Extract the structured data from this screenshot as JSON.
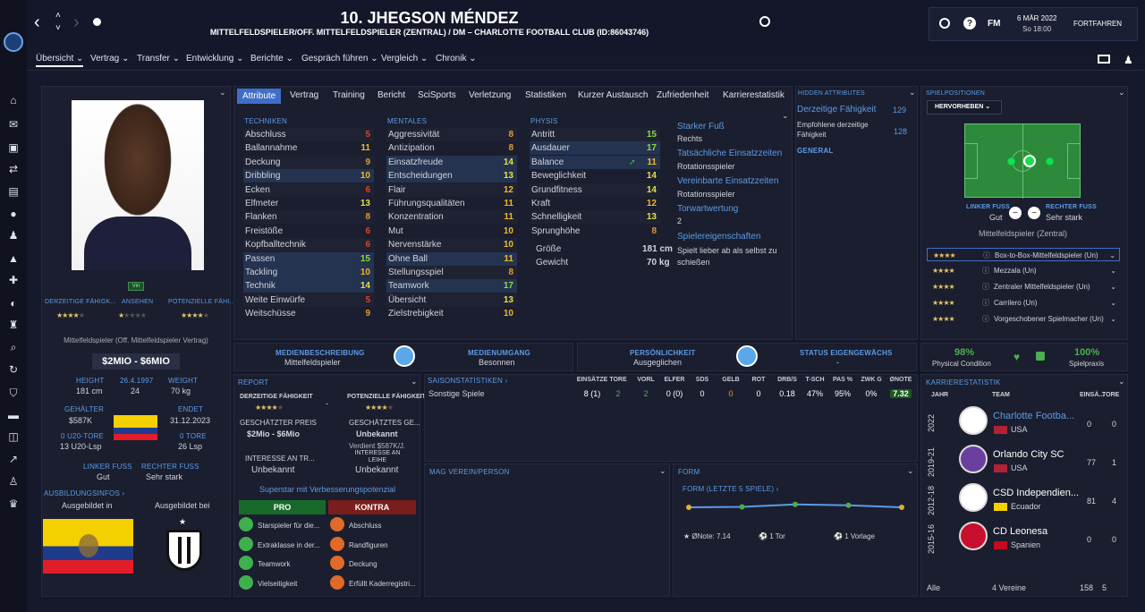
{
  "header": {
    "title": "10. JHEGSON MÉNDEZ",
    "subtitle": "MITTELFELDSPIELER/OFF. MITTELFELDSPIELER (ZENTRAL) / DM – CHARLOTTE FOOTBALL CLUB (ID:86043746)",
    "date": "6 MÄR 2022",
    "time": "So 18:00",
    "continue": "FORTFAHREN",
    "fm": "FM"
  },
  "menu": [
    "Übersicht",
    "Vertrag",
    "Transfer",
    "Entwicklung",
    "Berichte",
    "Gespräch führen",
    "Vergleich",
    "Chronik"
  ],
  "tabs": [
    "Attribute",
    "Vertrag",
    "Training",
    "Bericht",
    "SciSports",
    "Verletzung",
    "Statistiken",
    "Kurzer Austausch",
    "Zufriedenheit",
    "Karrierestatistik"
  ],
  "attributes": {
    "techniken_title": "TECHNIKEN",
    "mentales_title": "MENTALES",
    "physis_title": "PHYSIS",
    "techniken": [
      [
        "Abschluss",
        "5"
      ],
      [
        "Ballannahme",
        "11"
      ],
      [
        "Deckung",
        "9"
      ],
      [
        "Dribbling",
        "10"
      ],
      [
        "Ecken",
        "6"
      ],
      [
        "Elfmeter",
        "13"
      ],
      [
        "Flanken",
        "8"
      ],
      [
        "Freistöße",
        "6"
      ],
      [
        "Kopfballtechnik",
        "6"
      ],
      [
        "Passen",
        "15"
      ],
      [
        "Tackling",
        "10"
      ],
      [
        "Technik",
        "14"
      ],
      [
        "Weite Einwürfe",
        "5"
      ],
      [
        "Weitschüsse",
        "9"
      ]
    ],
    "mentales": [
      [
        "Aggressivität",
        "8"
      ],
      [
        "Antizipation",
        "8"
      ],
      [
        "Einsatzfreude",
        "14"
      ],
      [
        "Entscheidungen",
        "13"
      ],
      [
        "Flair",
        "12"
      ],
      [
        "Führungsqualitäten",
        "11"
      ],
      [
        "Konzentration",
        "11"
      ],
      [
        "Mut",
        "10"
      ],
      [
        "Nervenstärke",
        "10"
      ],
      [
        "Ohne Ball",
        "11"
      ],
      [
        "Stellungsspiel",
        "8"
      ],
      [
        "Teamwork",
        "17"
      ],
      [
        "Übersicht",
        "13"
      ],
      [
        "Zielstrebigkeit",
        "10"
      ]
    ],
    "physis": [
      [
        "Antritt",
        "15"
      ],
      [
        "Ausdauer",
        "17"
      ],
      [
        "Balance",
        "11"
      ],
      [
        "Beweglichkeit",
        "14"
      ],
      [
        "Grundfitness",
        "14"
      ],
      [
        "Kraft",
        "12"
      ],
      [
        "Schnelligkeit",
        "13"
      ],
      [
        "Sprunghöhe",
        "8"
      ]
    ],
    "size_label": "Größe",
    "size": "181 cm",
    "weight_label": "Gewicht",
    "weight": "70 kg"
  },
  "info": {
    "strong_foot_label": "Starker Fuß",
    "strong_foot": "Rechts",
    "actual_time_label": "Tatsächliche Einsatzzeiten",
    "actual_time": "Rotationsspieler",
    "agreed_time_label": "Vereinbarte Einsatzzeiten",
    "agreed_time": "Rotationsspieler",
    "goal_label": "Torwartwertung",
    "goal": "2",
    "traits_label": "Spielereigenschaften",
    "traits": "Spielt lieber ab als selbst zu schießen"
  },
  "hidden": {
    "title": "HIDDEN ATTRIBUTES",
    "current_label": "Derzeitige Fähigkeit",
    "current": "129",
    "rec_label": "Empfohlene derzeitige Fähigkeit",
    "rec": "128",
    "general": "GENERAL"
  },
  "positions": {
    "title": "SPIELPOSITIONEN",
    "highlight": "HERVORHEBEN",
    "left_foot_label": "LINKER FUSS",
    "left_foot": "Gut",
    "right_foot_label": "RECHTER FUSS",
    "right_foot": "Sehr stark",
    "pos_name": "Mittelfeldspieler (Zentral)",
    "roles": [
      "Box-to-Box-Mittelfeldspieler (Un)",
      "Mezzala (Un)",
      "Zentraler Mittelfeldspieler (Un)",
      "Carrilero (Un)",
      "Vorgeschobener Spielmacher (Un)"
    ],
    "condition": "98%",
    "condition_label": "Physical Condition",
    "practice": "100%",
    "practice_label": "Spielpraxis"
  },
  "profile": {
    "badge": "Vin",
    "cur_label": "DERZEITIGE FÄHIGK...",
    "rep_label": "ANSEHEN",
    "pot_label": "POTENZIELLE FÄHI...",
    "role": "Mittelfeldspieler (Off. Mittelfeldspieler Vertrag)",
    "value": "$2MIO - $6MIO",
    "height_label": "HEIGHT",
    "height": "181 cm",
    "age_label": "26.4.1997",
    "age": "24",
    "weight_label": "WEIGHT",
    "weight": "70 kg",
    "salary_label": "GEHÄLTER",
    "salary": "$587K",
    "ends_label": "ENDET",
    "ends": "31.12.2023",
    "u20_label": "0 U20-TORE",
    "u20": "13 U20-Lsp",
    "goals_label": "0 TORE",
    "goals": "26 Lsp",
    "lf_label": "LINKER FUSS",
    "lf": "Gut",
    "rf_label": "RECHTER FUSS",
    "rf": "Sehr stark",
    "training_title": "AUSBILDUNGSINFOS",
    "trained_in": "Ausgebildet in",
    "trained_at": "Ausgebildet bei"
  },
  "media": {
    "desc_label": "MEDIENBESCHREIBUNG",
    "desc": "Mittelfeldspieler",
    "handling_label": "MEDIENUMGANG",
    "handling": "Besonnen",
    "pers_label": "PERSÖNLICHKEIT",
    "pers": "Ausgeglichen",
    "status_label": "STATUS EIGENGEWÄCHS",
    "status": "-"
  },
  "report": {
    "title": "REPORT",
    "cur_label": "DERZEITIGE FÄHIGKEIT",
    "pot_label": "POTENZIELLE FÄHIGKEIT",
    "price_label": "GESCHÄTZTER PREIS",
    "price": "$2Mio - $6Mio",
    "salary_label": "GESCHÄTZTES GE...",
    "salary": "Unbekannt",
    "salary_note": "Verdient $587K/J.",
    "interest_label": "INTERESSE AN TR...",
    "interest": "Unbekannt",
    "loan_label": "INTERESSE AN LEIHE",
    "loan": "Unbekannt",
    "summary": "Superstar mit Verbesserungspotenzial",
    "pro": "PRO",
    "contra": "KONTRA",
    "pros": [
      "Starspieler für die...",
      "Extraklasse in der...",
      "Teamwork",
      "Vielseitigkeit"
    ],
    "cons": [
      "Abschluss",
      "Randfiguren",
      "Deckung",
      "Erfüllt Kaderregistri..."
    ]
  },
  "season": {
    "title": "SAISONSTATISTIKEN",
    "headers": [
      "EINSÄTZE",
      "TORE",
      "VORL",
      "ELFER",
      "SDS",
      "GELB",
      "ROT",
      "DRB/S",
      "T-SCH",
      "PAS %",
      "ZWK G",
      "ØNOTE"
    ],
    "row_label": "Sonstige Spiele",
    "values": [
      "8 (1)",
      "2",
      "2",
      "0 (0)",
      "0",
      "0",
      "0",
      "0.18",
      "47%",
      "95%",
      "0%",
      "7.32"
    ]
  },
  "fav": {
    "title": "MAG VEREIN/PERSON"
  },
  "form": {
    "title": "FORM",
    "sub": "FORM (LETZTE 5 SPIELE)",
    "note": "ØNote: 7.14",
    "goals": "1 Tor",
    "assists": "1 Vorlage"
  },
  "career": {
    "title": "KARRIERESTATISTIK",
    "year_label": "JAHR",
    "team_label": "TEAM",
    "apps_label": "EINSÄ...",
    "goals_label": "TORE",
    "rows": [
      {
        "year": "2022",
        "team": "Charlotte Footba...",
        "country": "USA",
        "apps": "0",
        "goals": "0"
      },
      {
        "year": "2019-21",
        "team": "Orlando City SC",
        "country": "USA",
        "apps": "77",
        "goals": "1"
      },
      {
        "year": "2012-18",
        "team": "CSD Independien...",
        "country": "Ecuador",
        "apps": "81",
        "goals": "4"
      },
      {
        "year": "2015-16",
        "team": "CD Leonesa",
        "country": "Spanien",
        "apps": "0",
        "goals": "0"
      }
    ],
    "total_label": "Alle",
    "total_teams": "4 Vereine",
    "total_apps": "158",
    "total_goals": "5"
  },
  "chart_data": {
    "type": "line",
    "title": "FORM (LETZTE 5 SPIELE)",
    "categories": [
      "1",
      "2",
      "3",
      "4",
      "5"
    ],
    "values": [
      7.0,
      7.05,
      7.3,
      7.2,
      7.0
    ],
    "ylim": [
      6,
      8
    ]
  }
}
